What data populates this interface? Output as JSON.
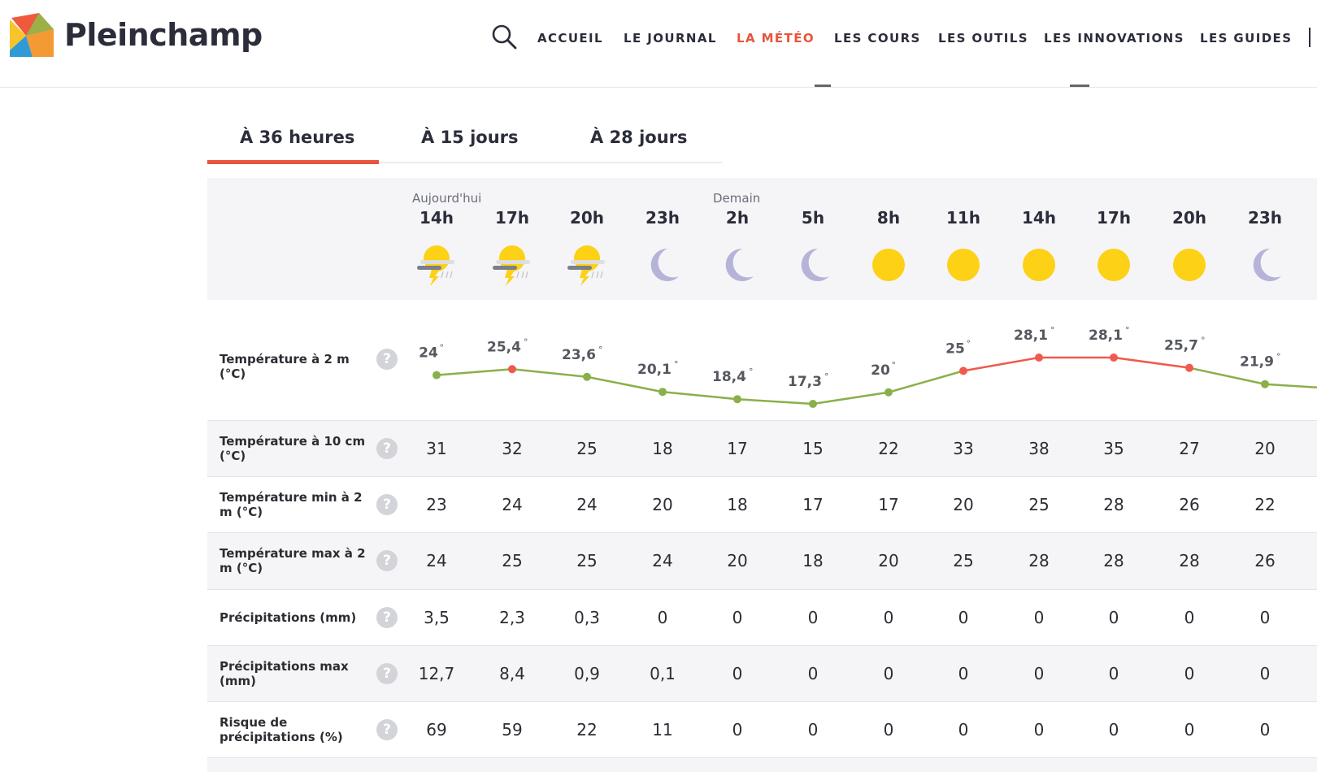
{
  "header": {
    "brand": "Pleinchamp",
    "nav": [
      {
        "label": "ACCUEIL",
        "active": false
      },
      {
        "label": "LE JOURNAL",
        "active": false
      },
      {
        "label": "LA MÉTÉO",
        "active": true
      },
      {
        "label": "LES COURS",
        "active": false
      },
      {
        "label": "LES OUTILS",
        "active": false
      },
      {
        "label": "LES INNOVATIONS",
        "active": false
      },
      {
        "label": "LES GUIDES",
        "active": false
      }
    ],
    "accent_color": "#e8543c"
  },
  "tabs": [
    {
      "label": "À 36 heures",
      "active": true
    },
    {
      "label": "À 15 jours",
      "active": false
    },
    {
      "label": "À 28 jours",
      "active": false
    }
  ],
  "forecast": {
    "day_labels": [
      "Aujourd'hui",
      "Demain"
    ],
    "hours": [
      "14h",
      "17h",
      "20h",
      "23h",
      "2h",
      "5h",
      "8h",
      "11h",
      "14h",
      "17h",
      "20h",
      "23h"
    ],
    "icons": [
      "thunderstorm-icon",
      "thunderstorm-icon",
      "thunderstorm-icon",
      "moon-icon",
      "moon-icon",
      "moon-icon",
      "sun-icon",
      "sun-icon",
      "sun-icon",
      "sun-icon",
      "sun-icon",
      "moon-icon"
    ]
  },
  "temperature_2m": {
    "label": "Température à 2 m (°C)",
    "help": "?",
    "values": [
      24,
      25.4,
      23.6,
      20.1,
      18.4,
      17.3,
      20,
      25,
      28.1,
      28.1,
      25.7,
      21.9
    ],
    "display": [
      "24",
      "25,4",
      "23,6",
      "20,1",
      "18,4",
      "17,3",
      "20",
      "25",
      "28,1",
      "28,1",
      "25,7",
      "21,9"
    ],
    "degree": "°",
    "hot_color": "#ef5a4c",
    "cool_color": "#8ab04a",
    "threshold": 25
  },
  "rows": [
    {
      "label": "Température à 10 cm (°C)",
      "help": "?",
      "values": [
        "31",
        "32",
        "25",
        "18",
        "17",
        "15",
        "22",
        "33",
        "38",
        "35",
        "27",
        "20"
      ]
    },
    {
      "label": "Température min à 2 m (°C)",
      "help": "?",
      "values": [
        "23",
        "24",
        "24",
        "20",
        "18",
        "17",
        "17",
        "20",
        "25",
        "28",
        "26",
        "22"
      ]
    },
    {
      "label": "Température max à 2 m (°C)",
      "help": "?",
      "values": [
        "24",
        "25",
        "25",
        "24",
        "20",
        "18",
        "20",
        "25",
        "28",
        "28",
        "28",
        "26"
      ]
    },
    {
      "label": "Précipitations (mm)",
      "help": "?",
      "values": [
        "3,5",
        "2,3",
        "0,3",
        "0",
        "0",
        "0",
        "0",
        "0",
        "0",
        "0",
        "0",
        "0"
      ]
    },
    {
      "label": "Précipitations max (mm)",
      "help": "?",
      "values": [
        "12,7",
        "8,4",
        "0,9",
        "0,1",
        "0",
        "0",
        "0",
        "0",
        "0",
        "0",
        "0",
        "0"
      ]
    },
    {
      "label": "Risque de précipitations (%)",
      "help": "?",
      "values": [
        "69",
        "59",
        "22",
        "11",
        "0",
        "0",
        "0",
        "0",
        "0",
        "0",
        "0",
        "0"
      ]
    }
  ]
}
